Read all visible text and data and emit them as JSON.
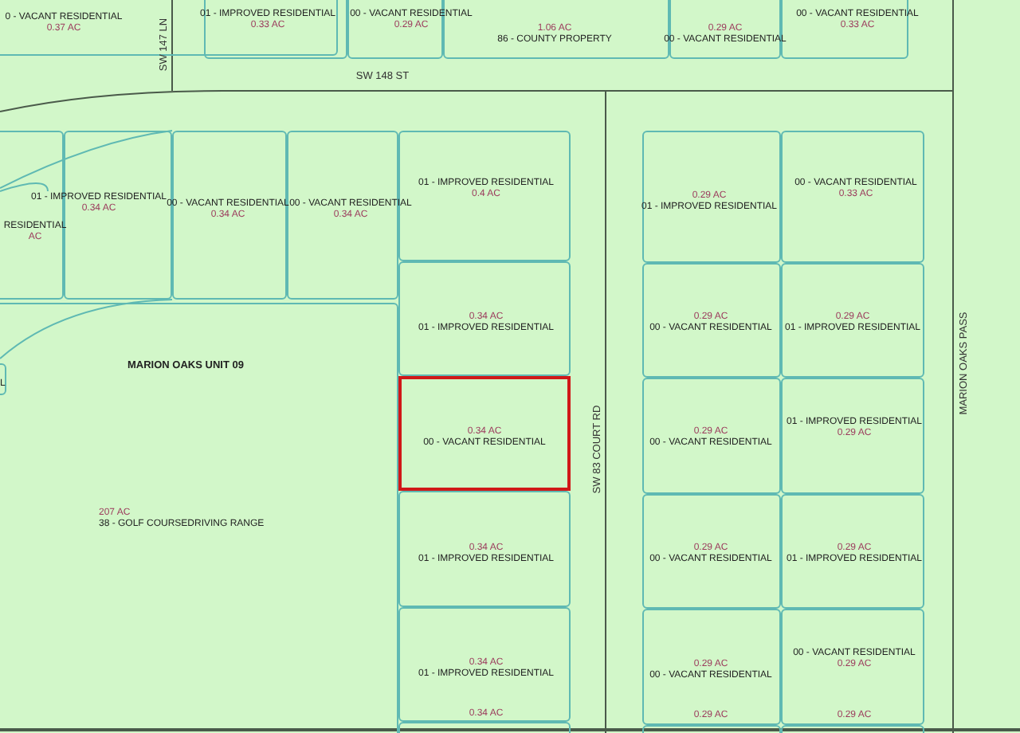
{
  "streets": [
    {
      "name": "SW 148 ST"
    },
    {
      "name": "SW 147 LN"
    },
    {
      "name": "SW 83 COURT RD"
    },
    {
      "name": "MARION OAKS PASS"
    }
  ],
  "area_labels": [
    "MARION OAKS UNIT 09"
  ],
  "parcels": [
    {
      "use": "0 - VACANT RESIDENTIAL",
      "acreage": "0.37 AC",
      "selected": false
    },
    {
      "use": "01 - IMPROVED RESIDENTIAL",
      "acreage": "0.33 AC",
      "selected": false
    },
    {
      "use": "00 - VACANT RESIDENTIAL",
      "acreage": "0.29 AC",
      "selected": false
    },
    {
      "acreage": "1.06 AC",
      "use": "86 - COUNTY PROPERTY",
      "selected": false
    },
    {
      "acreage": "0.29 AC",
      "use": "00 - VACANT RESIDENTIAL",
      "selected": false
    },
    {
      "use": "00 - VACANT RESIDENTIAL",
      "acreage": "0.33 AC",
      "selected": false
    },
    {
      "use": "RESIDENTIAL",
      "acreage": "AC",
      "selected": false
    },
    {
      "use": "01 - IMPROVED RESIDENTIAL",
      "acreage": "0.34 AC",
      "selected": false
    },
    {
      "use": "00 - VACANT RESIDENTIAL",
      "acreage": "0.34 AC",
      "selected": false
    },
    {
      "use": "00 - VACANT RESIDENTIAL",
      "acreage": "0.34 AC",
      "selected": false
    },
    {
      "use": "01 - IMPROVED RESIDENTIAL",
      "acreage": "0.4 AC",
      "selected": false
    },
    {
      "acreage": "0.34 AC",
      "use": "01 - IMPROVED RESIDENTIAL",
      "selected": false
    },
    {
      "acreage": "0.34 AC",
      "use": "00 - VACANT RESIDENTIAL",
      "selected": true
    },
    {
      "acreage": "0.34 AC",
      "use": "01 - IMPROVED RESIDENTIAL",
      "selected": false
    },
    {
      "acreage": "0.34 AC",
      "use": "01 - IMPROVED RESIDENTIAL",
      "selected": false
    },
    {
      "acreage": "0.34 AC",
      "selected": false
    },
    {
      "acreage": "0.29 AC",
      "use": "01 - IMPROVED RESIDENTIAL",
      "selected": false
    },
    {
      "use": "00 - VACANT RESIDENTIAL",
      "acreage": "0.33 AC",
      "selected": false
    },
    {
      "acreage": "0.29 AC",
      "use": "00 - VACANT RESIDENTIAL",
      "selected": false
    },
    {
      "acreage": "0.29 AC",
      "use": "01 - IMPROVED RESIDENTIAL",
      "selected": false
    },
    {
      "acreage": "0.29 AC",
      "use": "00 - VACANT RESIDENTIAL",
      "selected": false
    },
    {
      "use": "01 - IMPROVED RESIDENTIAL",
      "acreage": "0.29 AC",
      "selected": false
    },
    {
      "acreage": "0.29 AC",
      "use": "00 - VACANT RESIDENTIAL",
      "selected": false
    },
    {
      "acreage": "0.29 AC",
      "use": "01 - IMPROVED RESIDENTIAL",
      "selected": false
    },
    {
      "acreage": "0.29 AC",
      "use": "00 - VACANT RESIDENTIAL",
      "selected": false
    },
    {
      "use": "00 - VACANT RESIDENTIAL",
      "acreage": "0.29 AC",
      "selected": false
    },
    {
      "acreage": "0.29 AC",
      "selected": false
    },
    {
      "acreage": "0.29 AC",
      "selected": false
    },
    {
      "acreage": "207 AC",
      "use": "38 - GOLF COURSEDRIVING RANGE",
      "selected": false
    },
    {
      "use": "L",
      "selected": false
    }
  ]
}
